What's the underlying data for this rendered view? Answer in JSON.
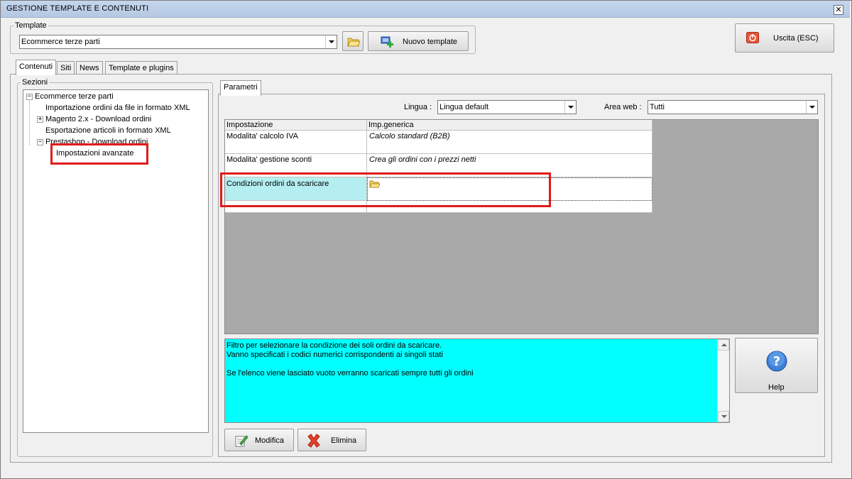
{
  "window": {
    "title": "GESTIONE TEMPLATE E CONTENUTI",
    "close_symbol": "✕"
  },
  "template_group": {
    "legend": "Template",
    "selected": "Ecommerce terze parti",
    "new_button_label": "Nuovo template"
  },
  "exit_button_label": "Uscita (ESC)",
  "tabs": [
    "Contenuti",
    "Siti",
    "News",
    "Template e plugins"
  ],
  "sections": {
    "legend": "Sezioni",
    "tree": {
      "root": "Ecommerce terze parti",
      "items": [
        "Importazione ordini da file in formato XML",
        "Magento 2.x - Download ordini",
        "Esportazione articoli in formato XML",
        "Prestashop - Download ordini"
      ],
      "child": "Impostazioni avanzate"
    }
  },
  "params": {
    "tab_label": "Parametri",
    "lingua_label": "Lingua :",
    "lingua_value": "Lingua default",
    "area_label": "Area web :",
    "area_value": "Tutti",
    "grid": {
      "headers": [
        "Impostazione",
        "Imp.generica"
      ],
      "rows": [
        {
          "setting": "Modalita' calcolo IVA",
          "value": "Calcolo standard (B2B)"
        },
        {
          "setting": "Modalita' gestione sconti",
          "value": "Crea gli ordini con i prezzi netti"
        },
        {
          "setting": "Condizioni ordini da scaricare",
          "value": ""
        }
      ]
    },
    "description": {
      "line1": "Filtro per selezionare la condizione dei soli ordini da scaricare.",
      "line2": "Vanno specificati i codici numerici corrispondenti ai singoli stati",
      "line3": "Se l'elenco viene lasciato vuoto verranno scaricati sempre tutti gli ordini"
    },
    "help_label": "Help",
    "modify_label": "Modifica",
    "delete_label": "Elimina"
  },
  "colors": {
    "highlight_red": "#e01b1b",
    "selected_cell": "#b4eef0",
    "description_bg": "#00ffff",
    "grid_bg": "#a9a9a9"
  }
}
